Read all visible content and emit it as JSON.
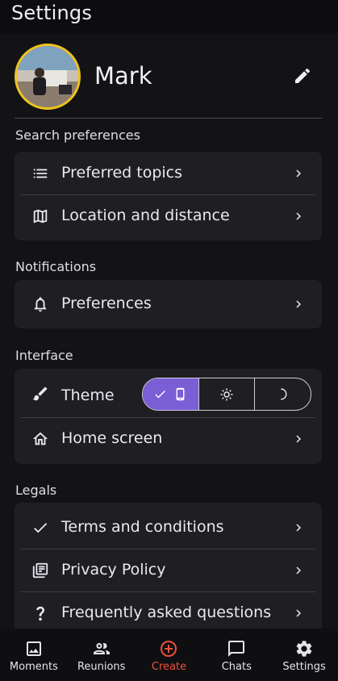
{
  "title": "Settings",
  "profile": {
    "name": "Mark"
  },
  "sections": {
    "search": {
      "label": "Search preferences",
      "items": [
        {
          "label": "Preferred topics",
          "icon": "list-icon"
        },
        {
          "label": "Location and distance",
          "icon": "map-icon"
        }
      ]
    },
    "notifications": {
      "label": "Notifications",
      "items": [
        {
          "label": "Preferences",
          "icon": "bell-icon"
        }
      ]
    },
    "interface": {
      "label": "Interface",
      "theme_label": "Theme",
      "theme_options": [
        "system",
        "light",
        "dark"
      ],
      "theme_selected": "system",
      "items": [
        {
          "label": "Home screen",
          "icon": "home-icon"
        }
      ]
    },
    "legals": {
      "label": "Legals",
      "items": [
        {
          "label": "Terms and conditions",
          "icon": "check-icon"
        },
        {
          "label": "Privacy Policy",
          "icon": "document-icon"
        },
        {
          "label": "Frequently asked questions",
          "icon": "question-icon"
        }
      ]
    }
  },
  "nav": [
    {
      "label": "Moments",
      "icon": "photo-icon"
    },
    {
      "label": "Reunions",
      "icon": "people-icon"
    },
    {
      "label": "Create",
      "icon": "add-circle-icon",
      "active": true
    },
    {
      "label": "Chats",
      "icon": "chat-icon"
    },
    {
      "label": "Settings",
      "icon": "gear-icon"
    }
  ],
  "colors": {
    "background": "#131316",
    "card": "#1f1e23",
    "accent": "#7a5ed6",
    "active_nav": "#f0503c",
    "avatar_ring": "#f2c21b"
  }
}
